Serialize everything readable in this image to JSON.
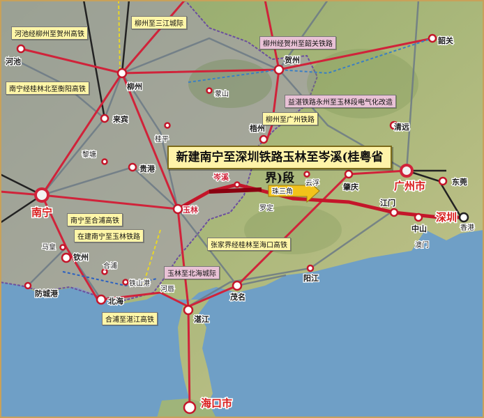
{
  "banner": "新建南宁至深圳铁路玉林至岑溪(桂粤省界)段",
  "labels": {
    "pearl_delta": "珠三角"
  },
  "cities": {
    "nanning": "南宁",
    "liuzhou": "柳州",
    "hechi": "河池",
    "laibin": "来宾",
    "guigang": "贵港",
    "yulin": "玉林",
    "qinzhou": "钦州",
    "beihai": "北海",
    "fangchenggang": "防城港",
    "hepu": "合浦",
    "tieshangang": "铁山港",
    "mashan": "马皇",
    "lihe": "黎塘",
    "guiping": "桂平",
    "mengshan": "蒙山",
    "hezhou": "贺州",
    "wuzhou": "梧州",
    "cenxi": "岑溪",
    "yunfu": "云浮",
    "luoding": "罗定",
    "zhaoqing": "肇庆",
    "guangzhou": "广州市",
    "dongguan": "东莞",
    "shenzhen": "深圳",
    "hongkong": "香港",
    "macau": "澳门",
    "jiangmen": "江门",
    "zhongshan": "中山",
    "yangjiang": "阳江",
    "maoming": "茂名",
    "zhanjiang": "湛江",
    "lianjiang": "河唇",
    "haikou": "海口市",
    "qingyuan": "清远",
    "shaoguan": "韶关"
  },
  "callouts": {
    "hechi_hezhou": "河池经柳州至贺州高铁",
    "liuzhou_sanjiang": "柳州至三江城际",
    "nanning_hengyang": "南宁经桂林北至衡阳高铁",
    "liuzhou_shaoguan": "柳州经贺州至韶关铁路",
    "yizhan": "益湛铁路永州至玉林段电气化改造",
    "liuzhou_guangzhou": "柳州至广州铁路",
    "nanning_hepu": "南宁至合浦高铁",
    "nanning_yulin": "在建南宁至玉林铁路",
    "zhangjiajie_haikou": "张家界经桂林至海口高铁",
    "yulin_beihai": "玉林至北海城际",
    "hepu_zhanjiang": "合浦至湛江高铁"
  }
}
